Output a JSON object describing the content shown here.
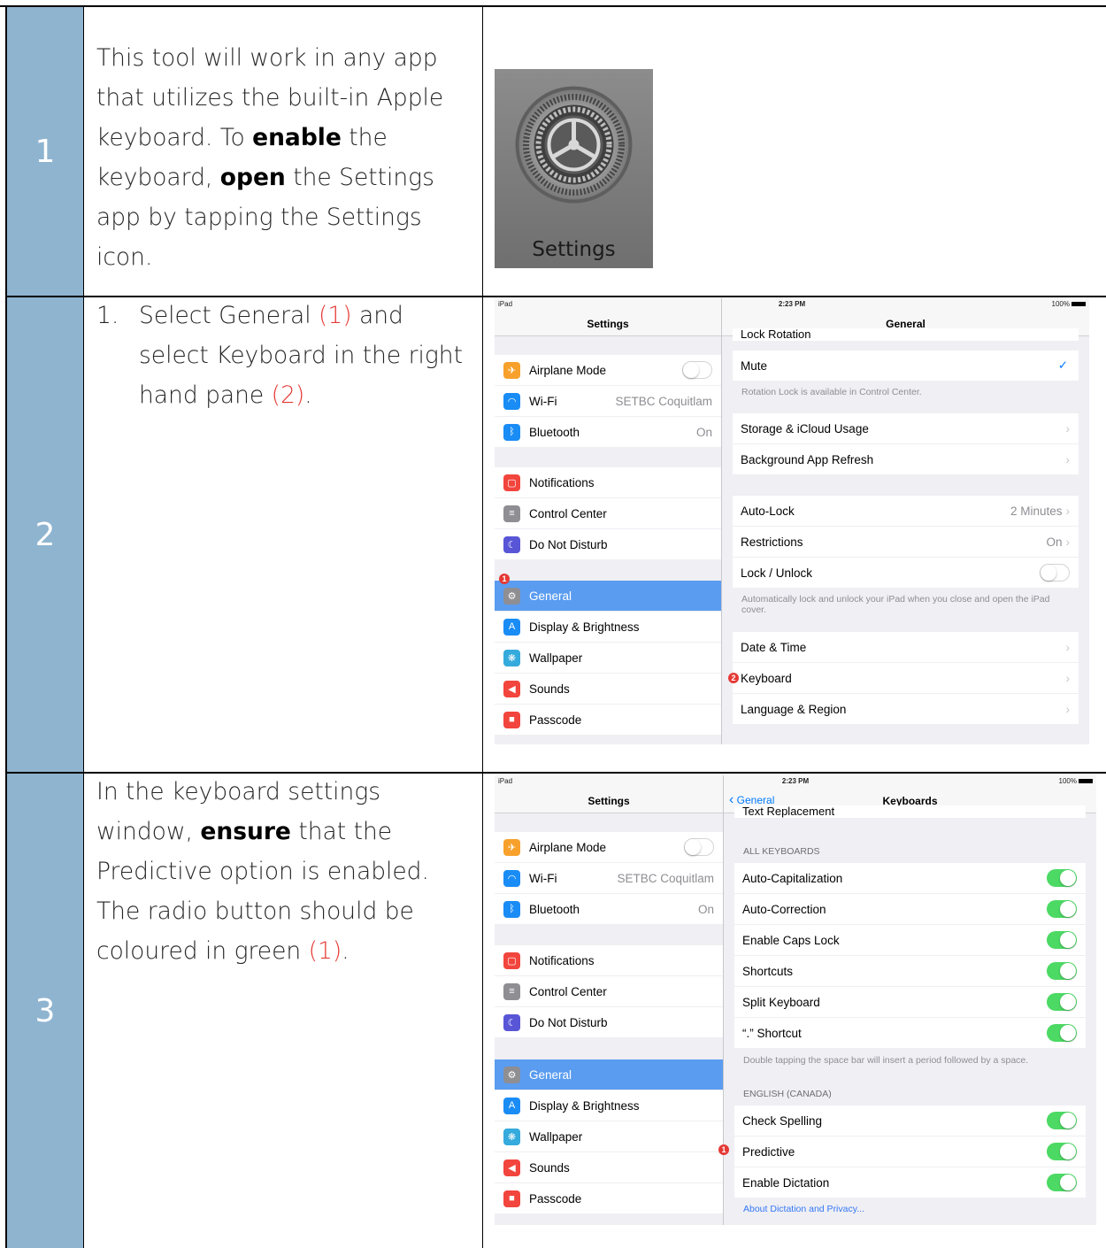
{
  "colors": {
    "num_bg": "#8FB4D0",
    "accent_red": "#E53935",
    "ios_blue": "#5a9cf0",
    "toggle_green": "#4cd964"
  },
  "step1": {
    "num": "1",
    "t1": "This tool will work in any app that utilizes the built-in Apple keyboard.  To ",
    "b1": "enable",
    "t2": " the keyboard, ",
    "b2": "open",
    "t3": " the Settings app by tapping the Settings icon.",
    "icon_label": "Settings"
  },
  "step2": {
    "num": "2",
    "marker": "1.",
    "t1": "Select General ",
    "r1": "(1)",
    "t2": " and select Keyboard in the right hand pane ",
    "r2": "(2)",
    "t3": ".",
    "screen": {
      "status_left": "iPad",
      "status_time": "2:23 PM",
      "status_right": "100%",
      "left_title": "Settings",
      "right_title": "General",
      "cut_row": "Lock Rotation",
      "left_items": [
        {
          "label": "Airplane Mode",
          "icon": "airplane-icon",
          "color": "#f7a12c"
        },
        {
          "label": "Wi-Fi",
          "value": "SETBC Coquitlam",
          "icon": "wifi-icon",
          "color": "#1a8cf5"
        },
        {
          "label": "Bluetooth",
          "value": "On",
          "icon": "bluetooth-icon",
          "color": "#1a8cf5"
        },
        {
          "label": "Notifications",
          "icon": "notifications-icon",
          "color": "#f2453d"
        },
        {
          "label": "Control Center",
          "icon": "control-center-icon",
          "color": "#8e8e93"
        },
        {
          "label": "Do Not Disturb",
          "icon": "moon-icon",
          "color": "#5856d6"
        },
        {
          "label": "General",
          "icon": "gear-icon",
          "color": "#8e8e93"
        },
        {
          "label": "Display & Brightness",
          "icon": "display-icon",
          "color": "#1a8cf5"
        },
        {
          "label": "Wallpaper",
          "icon": "wallpaper-icon",
          "color": "#35aadc"
        },
        {
          "label": "Sounds",
          "icon": "sounds-icon",
          "color": "#f2453d"
        },
        {
          "label": "Passcode",
          "icon": "lock-icon",
          "color": "#f2453d"
        }
      ],
      "right_items": {
        "mute": "Mute",
        "rotation_note": "Rotation Lock is available in Control Center.",
        "storage": "Storage & iCloud Usage",
        "bg_refresh": "Background App Refresh",
        "autolock": "Auto-Lock",
        "autolock_value": "2 Minutes",
        "restrictions": "Restrictions",
        "restrictions_value": "On",
        "lock_unlock": "Lock / Unlock",
        "lock_note": "Automatically lock and unlock your iPad when you close and open the iPad cover.",
        "date_time": "Date & Time",
        "keyboard": "Keyboard",
        "language": "Language & Region"
      },
      "badge1": "1",
      "badge2": "2"
    }
  },
  "step3": {
    "num": "3",
    "t1": "In the keyboard settings window, ",
    "b1": "ensure",
    "t2": " that the Predictive option is enabled. The radio button should be coloured in green ",
    "r1": "(1)",
    "t3": ".",
    "screen": {
      "status_left": "iPad",
      "status_time": "2:23 PM",
      "status_right": "100%",
      "left_title": "Settings",
      "back_label": "General",
      "right_title": "Keyboards",
      "cut_row": "Text Replacement",
      "header_all": "ALL KEYBOARDS",
      "all_items": [
        "Auto-Capitalization",
        "Auto-Correction",
        "Enable Caps Lock",
        "Shortcuts",
        "Split Keyboard",
        "“.” Shortcut"
      ],
      "shortcut_note": "Double tapping the space bar will insert a period followed by a space.",
      "header_lang": "ENGLISH (CANADA)",
      "lang_items": [
        "Check Spelling",
        "Predictive",
        "Enable Dictation"
      ],
      "link": "About Dictation and Privacy...",
      "badge1": "1"
    }
  }
}
